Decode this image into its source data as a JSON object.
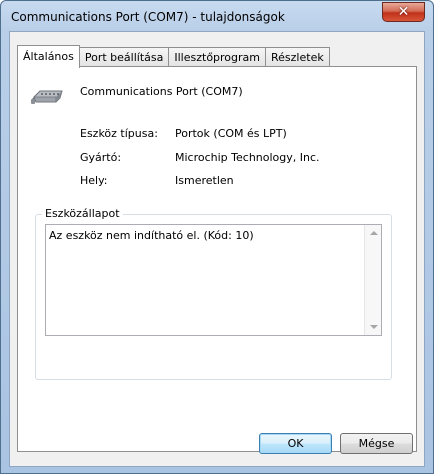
{
  "window": {
    "title": "Communications Port (COM7) - tulajdonságok",
    "close_symbol": "✕"
  },
  "tabs": [
    {
      "label": "Általános",
      "active": true
    },
    {
      "label": "Port beállítása",
      "active": false
    },
    {
      "label": "Illesztőprogram",
      "active": false
    },
    {
      "label": "Részletek",
      "active": false
    }
  ],
  "general": {
    "device_name": "Communications Port (COM7)",
    "device_icon": "serial-port-icon",
    "properties": [
      {
        "label": "Eszköz típusa:",
        "value": "Portok (COM és LPT)"
      },
      {
        "label": "Gyártó:",
        "value": "Microchip Technology, Inc."
      },
      {
        "label": "Hely:",
        "value": "Ismeretlen"
      }
    ],
    "status_group_title": "Eszközállapot",
    "status_text": "Az eszköz nem indítható el. (Kód: 10)"
  },
  "buttons": {
    "ok": "OK",
    "cancel": "Mégse"
  }
}
